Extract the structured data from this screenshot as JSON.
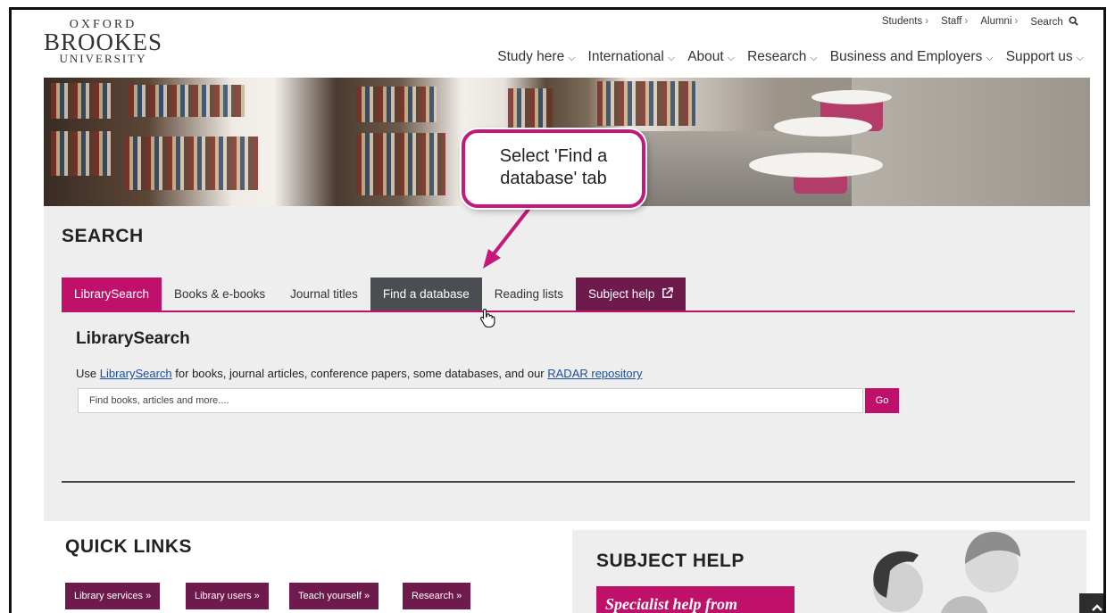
{
  "logo": {
    "line1": "OXFORD",
    "line2": "BROOKES",
    "line3": "UNIVERSITY"
  },
  "utility_nav": [
    {
      "label": "Students",
      "chev": "›"
    },
    {
      "label": "Staff",
      "chev": "›"
    },
    {
      "label": "Alumni",
      "chev": "›"
    }
  ],
  "utility_search": "Search",
  "main_nav": [
    {
      "label": "Study here",
      "chev": "⌵"
    },
    {
      "label": "International",
      "chev": "⌵"
    },
    {
      "label": "About",
      "chev": "⌵"
    },
    {
      "label": "Research",
      "chev": "⌵"
    },
    {
      "label": "Business and Employers",
      "chev": "⌵"
    },
    {
      "label": "Support us",
      "chev": "⌵"
    }
  ],
  "callout": {
    "line1": "Select 'Find a",
    "line2": "database' tab",
    "border_color": "#c4197a"
  },
  "search": {
    "heading": "SEARCH",
    "tabs": [
      {
        "label": "LibrarySearch",
        "state": "active"
      },
      {
        "label": "Books & e-books",
        "state": "normal"
      },
      {
        "label": "Journal titles",
        "state": "normal"
      },
      {
        "label": "Find a database",
        "state": "hover"
      },
      {
        "label": "Reading lists",
        "state": "normal"
      },
      {
        "label": "Subject help",
        "state": "external"
      }
    ],
    "panel_title": "LibrarySearch",
    "desc_prefix": "Use ",
    "desc_link1": "LibrarySearch",
    "desc_middle": " for books, journal articles, conference papers, some databases, and our ",
    "desc_link2": "RADAR repository",
    "input_placeholder": "Find books, articles and more....",
    "go_label": "Go"
  },
  "quick_links": {
    "heading": "QUICK LINKS",
    "buttons": [
      "Library services »",
      "Library users »",
      "Teach yourself »",
      "Research »"
    ]
  },
  "subject_help": {
    "heading": "SUBJECT HELP",
    "pink_text": "Specialist help from"
  },
  "colors": {
    "accent": "#c0116a",
    "plum": "#6e1a4c",
    "tab_hover": "#4a4d52"
  },
  "icons": {
    "search": "search-icon",
    "external": "external-link-icon",
    "back_to_top": "chevron-up-icon"
  }
}
